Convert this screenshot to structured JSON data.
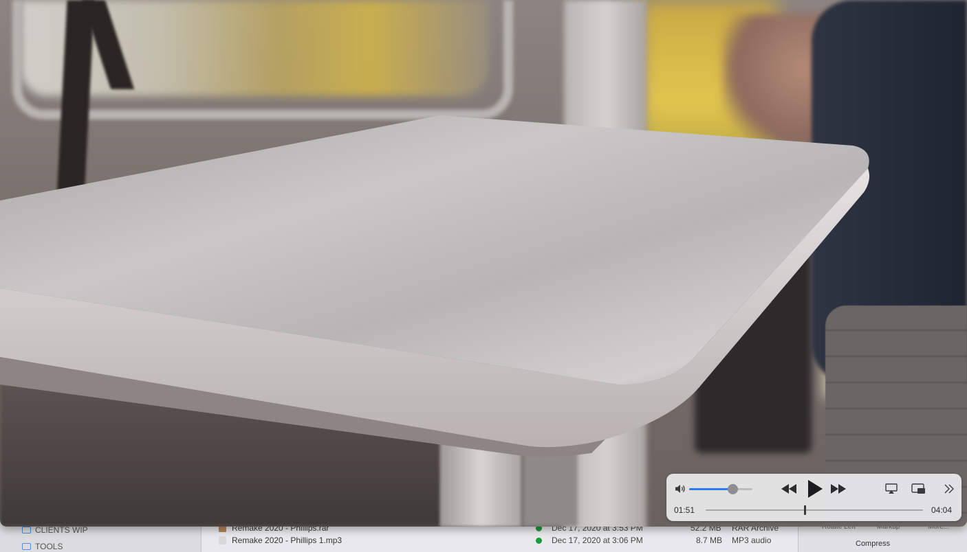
{
  "finder": {
    "sidebar": [
      {
        "label": "CLIENTS WIP",
        "icon": "folder-icon"
      },
      {
        "label": "TOOLS",
        "icon": "folder-icon"
      }
    ],
    "rows": [
      {
        "name": "Remake 2020 - Phillips.rar",
        "date": "Dec 17, 2020 at 3:53 PM",
        "size": "52.2 MB",
        "kind": "RAR Archive"
      },
      {
        "name": "Remake 2020 - Phillips 1.mp3",
        "date": "Dec 17, 2020 at 3:06 PM",
        "size": "8.7 MB",
        "kind": "MP3 audio"
      }
    ],
    "inspector": {
      "actions": [
        "Rotate Left",
        "Markup",
        "More..."
      ],
      "compress_label": "Compress"
    }
  },
  "player": {
    "controls": {
      "volume_icon": "speaker-icon",
      "volume_level": 0.68,
      "rewind_icon": "rewind-icon",
      "play_icon": "play-icon",
      "forward_icon": "fast-forward-icon",
      "airplay_icon": "airplay-icon",
      "pip_icon": "picture-in-picture-icon",
      "more_icon": "chevron-double-right-icon",
      "elapsed": "01:51",
      "duration": "04:04",
      "progress": 0.455
    }
  }
}
